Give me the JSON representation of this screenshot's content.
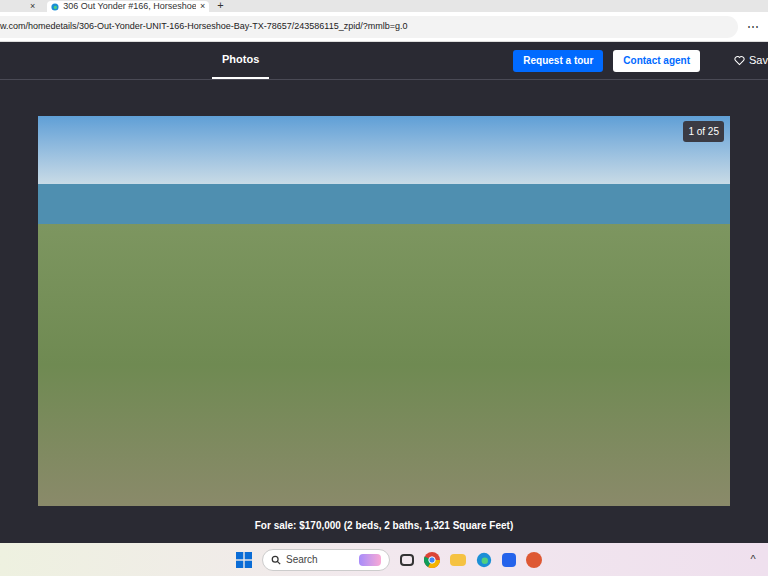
{
  "browser": {
    "prev_tab_close": "×",
    "tab": {
      "title": "306 Out Yonder #166, Horseshoe",
      "close": "×",
      "selected": true
    },
    "new_tab": "+",
    "url": "w.com/homedetails/306-Out-Yonder-UNIT-166-Horseshoe-Bay-TX-78657/243586115_zpid/?mmlb=g.0",
    "menu": "⋯"
  },
  "header": {
    "tabs": [
      {
        "label": "Photos",
        "selected": true
      }
    ],
    "buttons": [
      {
        "label": "Request a tour",
        "kind": "primary"
      },
      {
        "label": "Contact agent",
        "kind": "secondary"
      }
    ],
    "save": "Sav"
  },
  "photo": {
    "counter": "1 of 25"
  },
  "caption": "For sale: $170,000 (2 beds, 2 baths, 1,321 Square Feet)",
  "taskbar": {
    "search_placeholder": "Search",
    "overflow": "^"
  }
}
